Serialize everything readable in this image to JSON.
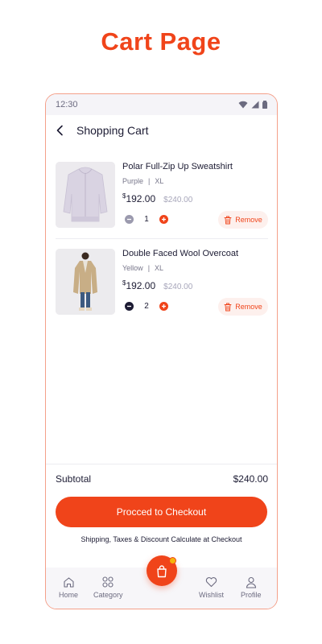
{
  "page_heading": "Cart Page",
  "status_bar": {
    "time": "12:30"
  },
  "header": {
    "title": "Shopping Cart"
  },
  "cart": {
    "items": [
      {
        "name": "Polar Full-Zip Up Sweatshirt",
        "color": "Purple",
        "separator": "|",
        "size": "XL",
        "currency": "$",
        "price": "192.00",
        "original_price": "$240.00",
        "quantity": "1",
        "remove_label": "Remove"
      },
      {
        "name": "Double Faced Wool Overcoat",
        "color": "Yellow",
        "separator": "|",
        "size": "XL",
        "currency": "$",
        "price": "192.00",
        "original_price": "$240.00",
        "quantity": "2",
        "remove_label": "Remove"
      }
    ]
  },
  "summary": {
    "subtotal_label": "Subtotal",
    "subtotal_value": "$240.00",
    "checkout_label": "Procced to Checkout",
    "note": "Shipping, Taxes & Discount Calculate at Checkout"
  },
  "tab_bar": {
    "home": "Home",
    "category": "Category",
    "wishlist": "Wishlist",
    "profile": "Profile"
  },
  "colors": {
    "accent": "#f0441a",
    "badge": "#f5b50a",
    "text": "#1c1b33"
  },
  "icons": [
    "wifi-icon",
    "signal-icon",
    "battery-icon",
    "back-icon",
    "trash-icon",
    "home-icon",
    "category-icon",
    "cart-bag-icon",
    "heart-icon",
    "profile-icon"
  ]
}
